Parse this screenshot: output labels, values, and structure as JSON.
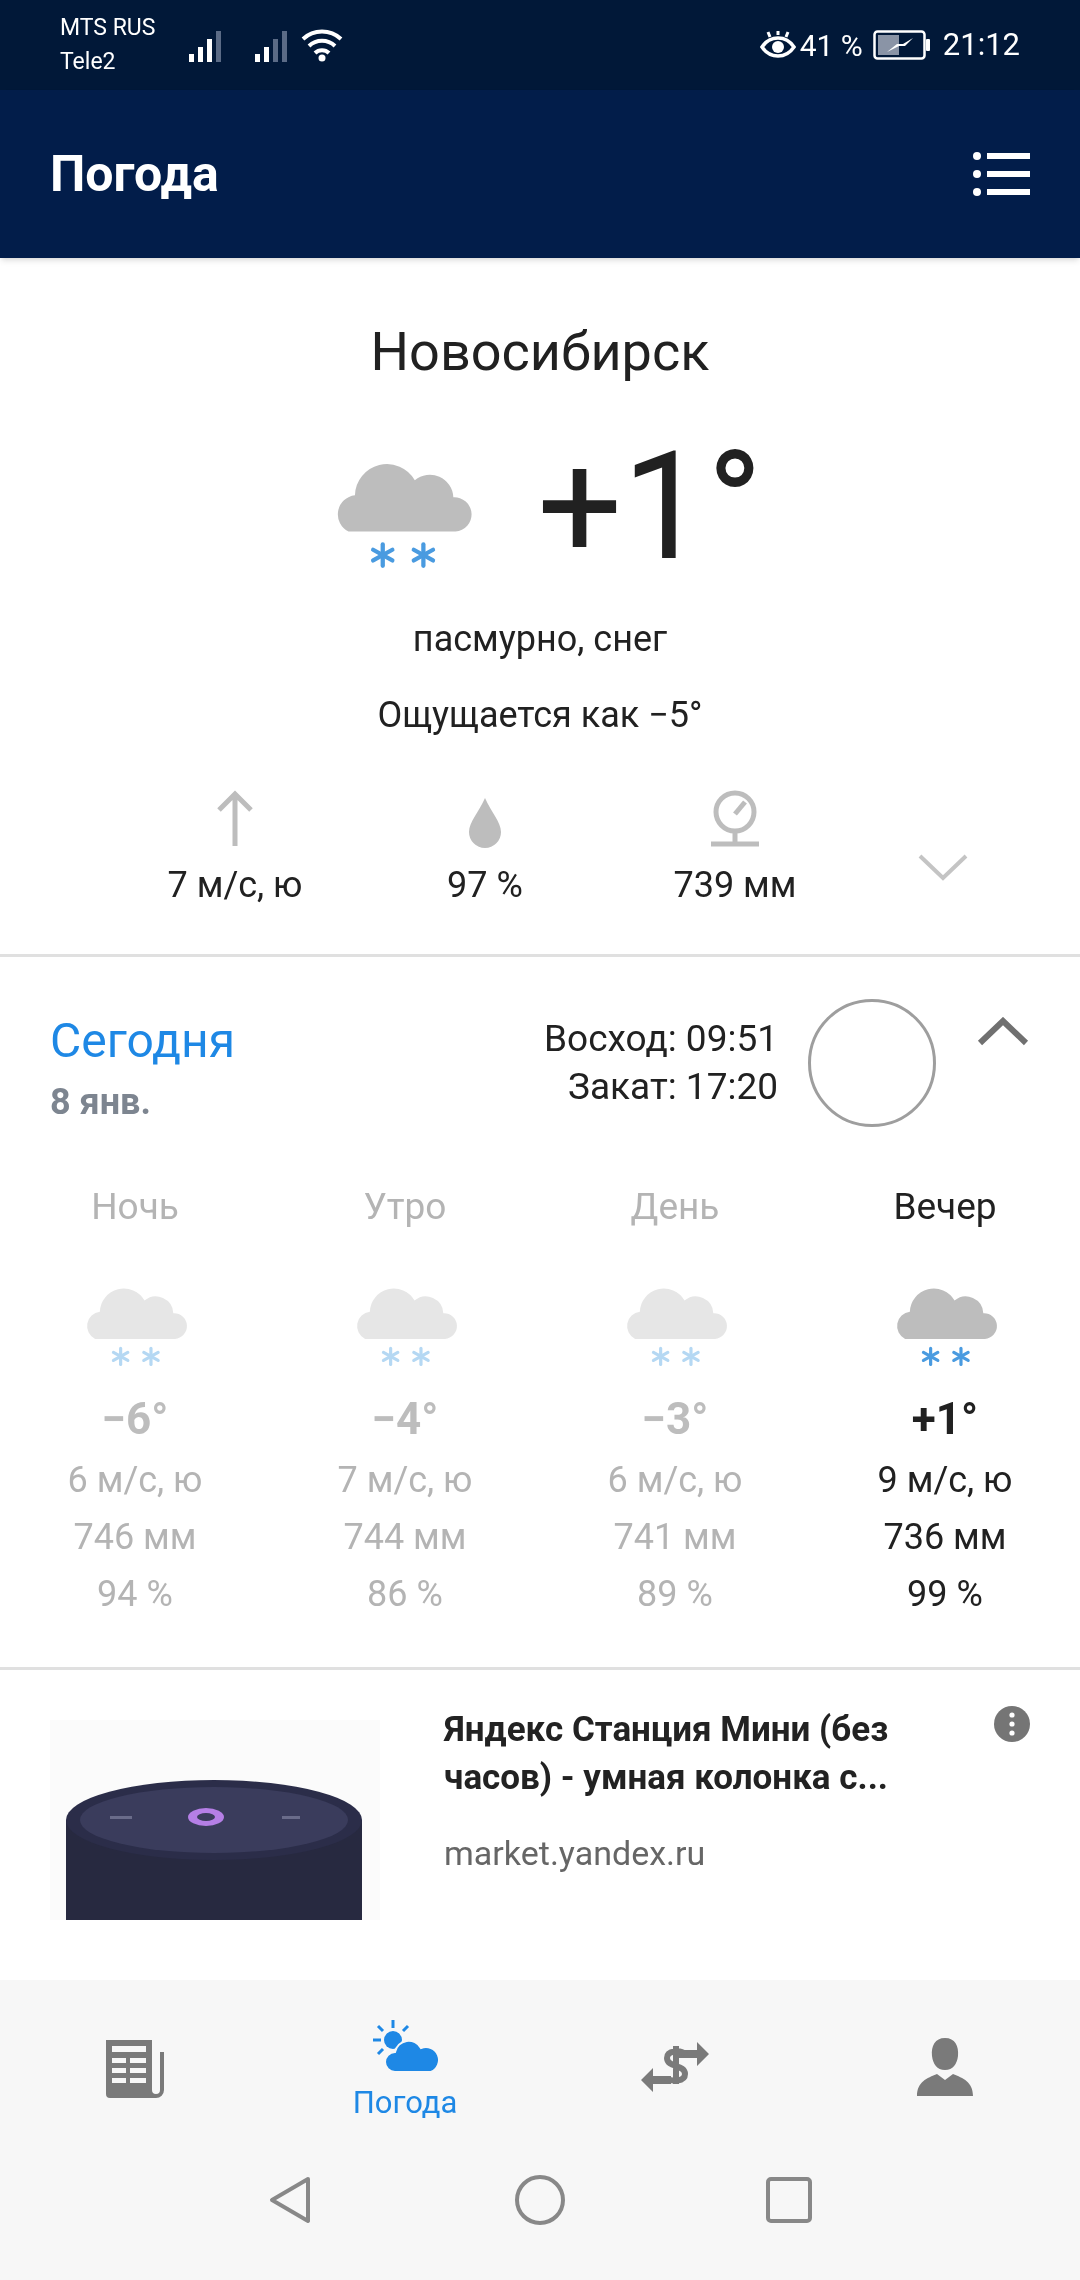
{
  "status_bar": {
    "carriers": [
      "MTS RUS",
      "Tele2"
    ],
    "battery": "41 %",
    "time": "21:12"
  },
  "app_bar": {
    "title": "Погода"
  },
  "current": {
    "city": "Новосибирск",
    "temperature": "+1°",
    "condition": "пасмурно, снег",
    "feels_like": "Ощущается как −5°",
    "expanded": false,
    "metrics": [
      {
        "kind": "wind",
        "value": "7 м/с, ю"
      },
      {
        "kind": "humidity",
        "value": "97 %"
      },
      {
        "kind": "pressure",
        "value": "739 мм"
      }
    ]
  },
  "today": {
    "title": "Сегодня",
    "date": "8 янв.",
    "sunrise": "Восход: 09:51",
    "sunset": "Закат: 17:20",
    "expanded": true,
    "periods": [
      {
        "name": "Ночь",
        "temperature": "−6°",
        "wind": "6 м/с, ю",
        "pressure": "746 мм",
        "humidity": "94 %",
        "selected": false
      },
      {
        "name": "Утро",
        "temperature": "−4°",
        "wind": "7 м/с, ю",
        "pressure": "744 мм",
        "humidity": "86 %",
        "selected": false
      },
      {
        "name": "День",
        "temperature": "−3°",
        "wind": "6 м/с, ю",
        "pressure": "741 мм",
        "humidity": "89 %",
        "selected": false
      },
      {
        "name": "Вечер",
        "temperature": "+1°",
        "wind": "9 м/с, ю",
        "pressure": "736 мм",
        "humidity": "99 %",
        "selected": true
      }
    ]
  },
  "ad": {
    "title": "Яндекс Станция Мини (без часов) - умная колонка с...",
    "domain": "market.yandex.ru"
  },
  "bottom_nav": [
    {
      "kind": "news",
      "selected": false
    },
    {
      "kind": "weather",
      "label": "Погода",
      "selected": true
    },
    {
      "kind": "currency",
      "selected": false
    },
    {
      "kind": "profile",
      "selected": false
    }
  ]
}
